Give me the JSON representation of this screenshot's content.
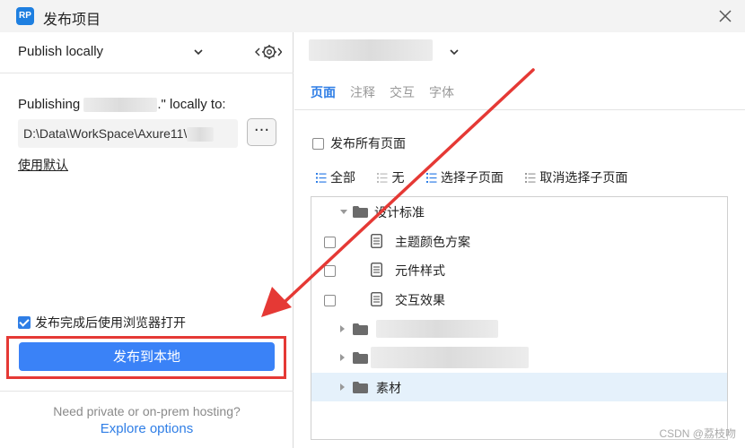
{
  "window": {
    "logo": "RP",
    "title": "发布项目"
  },
  "left": {
    "publish_mode": "Publish locally",
    "publishing_prefix": "Publishing ",
    "publishing_suffix": ".\" locally to:",
    "path_value": "D:\\Data\\WorkSpace\\Axure11\\",
    "browse_label": "···",
    "use_default": "使用默认",
    "open_browser_label": "发布完成后使用浏览器打开",
    "publish_button": "发布到本地",
    "hosting_text": "Need private or on-prem hosting?",
    "explore_link": "Explore options"
  },
  "right": {
    "tabs": [
      {
        "label": "页面",
        "active": true
      },
      {
        "label": "注释",
        "active": false
      },
      {
        "label": "交互",
        "active": false
      },
      {
        "label": "字体",
        "active": false
      }
    ],
    "publish_all": "发布所有页面",
    "toolbar": {
      "all": "全部",
      "none": "无",
      "select_children": "选择子页面",
      "deselect_children": "取消选择子页面"
    },
    "tree": {
      "folder1": "设计标准",
      "page1": "主题颜色方案",
      "page2": "元件样式",
      "page3": "交互效果",
      "folder4": "素材"
    }
  },
  "watermark": "CSDN @荔枝吻",
  "colors": {
    "accent": "#2f7ee6",
    "button": "#3a82f7",
    "annotation": "#e53935",
    "selected_row": "#e5f1fb"
  },
  "icons": [
    "app-logo-icon",
    "close-icon",
    "chevron-down-icon",
    "settings-icon",
    "folder-icon",
    "page-icon",
    "list-icon",
    "expand-triangle-icon"
  ]
}
